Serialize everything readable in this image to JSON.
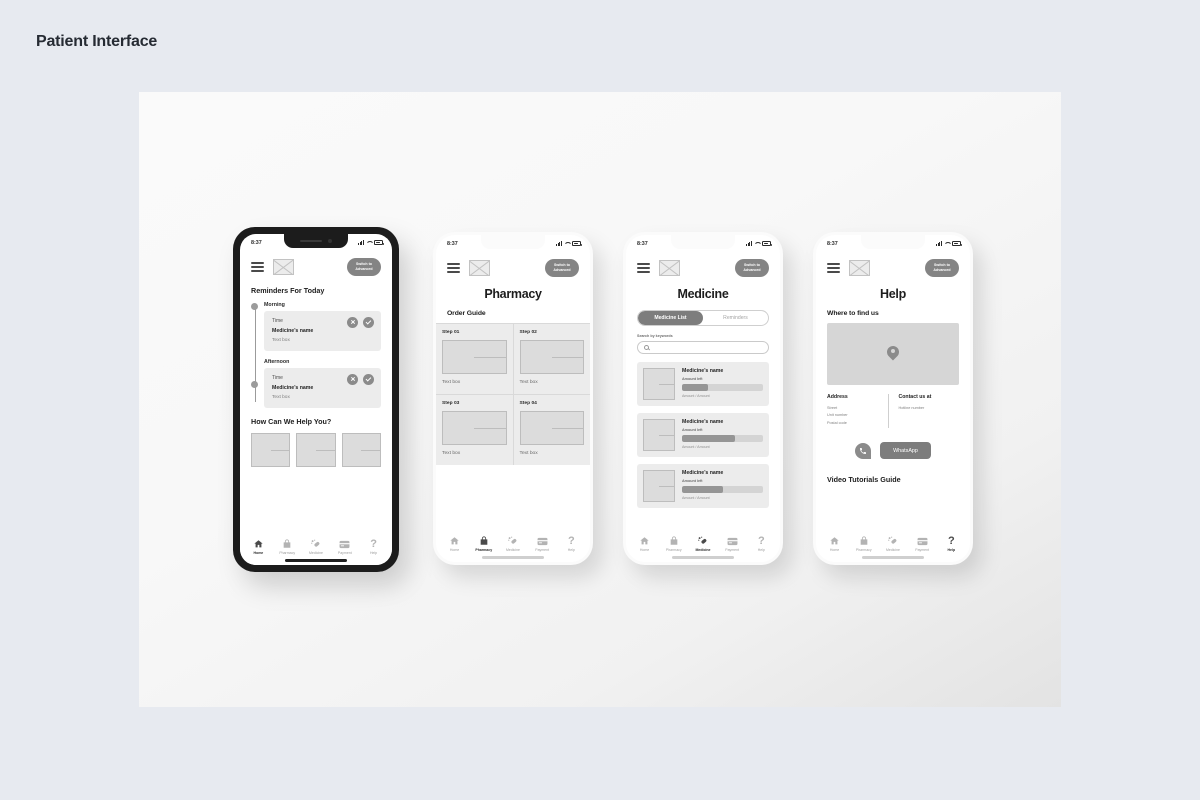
{
  "page": {
    "title": "Patient Interface"
  },
  "status_bar": {
    "time": "8:37"
  },
  "common": {
    "switch_button": "Switch to\nAdvanced",
    "nav": [
      {
        "label": "Home",
        "icon": "home-icon"
      },
      {
        "label": "Pharmacy",
        "icon": "bag-icon"
      },
      {
        "label": "Medicine",
        "icon": "pills-icon"
      },
      {
        "label": "Payment",
        "icon": "card-icon"
      },
      {
        "label": "Help",
        "icon": "question-icon"
      }
    ]
  },
  "screens": {
    "home": {
      "heading": "Reminders For Today",
      "reminders": [
        {
          "slot": "Morning",
          "time": "Time",
          "name": "Medicine's name",
          "desc": "Text box"
        },
        {
          "slot": "Afternoon",
          "time": "Time",
          "name": "Medicine's name",
          "desc": "Text box"
        }
      ],
      "help_heading": "How Can We Help You?",
      "help_tiles": [
        "tile-1",
        "tile-2",
        "tile-3"
      ],
      "active_nav": "Home"
    },
    "pharmacy": {
      "title": "Pharmacy",
      "section": "Order Guide",
      "steps": [
        {
          "label": "Step 01",
          "text": "Text box"
        },
        {
          "label": "Step 02",
          "text": "Text box"
        },
        {
          "label": "Step 03",
          "text": "Text box"
        },
        {
          "label": "Step 04",
          "text": "Text box"
        }
      ],
      "active_nav": "Pharmacy"
    },
    "medicine": {
      "title": "Medicine",
      "tabs": [
        {
          "label": "Medicine List",
          "active": true
        },
        {
          "label": "Reminders",
          "active": false
        }
      ],
      "search_label": "Search by keywords",
      "search_value": "",
      "search_placeholder": "",
      "items": [
        {
          "name": "Medicine's name",
          "amount_label": "Amount left",
          "progress": 32,
          "amount_text": "Amount / Amount"
        },
        {
          "name": "Medicine's name",
          "amount_label": "Amount left",
          "progress": 65,
          "amount_text": "Amount / Amount"
        },
        {
          "name": "Medicine's name",
          "amount_label": "Amount left",
          "progress": 50,
          "amount_text": "Amount / Amount"
        }
      ],
      "active_nav": "Medicine"
    },
    "help": {
      "title": "Help",
      "find_us_heading": "Where to find us",
      "map_pin": "location-pin-icon",
      "address_heading": "Address",
      "address_lines": [
        "Street",
        "Unit number",
        "Postal code"
      ],
      "contact_heading": "Contact us at",
      "contact_lines": [
        "Hotline number"
      ],
      "whatsapp_button": "WhatsApp",
      "phone_button": "phone-icon",
      "video_heading": "Video Tutorials Guide",
      "active_nav": "Help"
    }
  },
  "colors": {
    "page_bg": "#e7eaf0",
    "canvas_bg": "#f8f8f8",
    "accent_gray": "#7d7d7d",
    "card_gray": "#ececec",
    "placeholder_gray": "#dcdcdc"
  }
}
